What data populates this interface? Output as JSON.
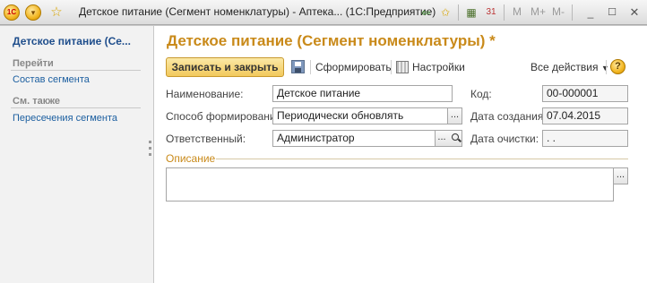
{
  "titlebar": {
    "logo": "1С",
    "title": "Детское питание (Сегмент номенклатуры) - Аптека... (1С:Предприятие)",
    "m_labels": [
      "M",
      "M+",
      "M-"
    ],
    "icons": [
      "app-logo-icon",
      "menu-dropdown-icon",
      "favorite-star-icon",
      "back-icon",
      "bookmark-icon",
      "calculator-icon",
      "calendar-icon",
      "minimize-icon",
      "maximize-icon",
      "close-icon"
    ]
  },
  "leftpanel": {
    "title": "Детское питание (Се...",
    "goto_section": "Перейти",
    "goto_items": [
      "Состав сегмента"
    ],
    "see_also_section": "См. также",
    "see_also_items": [
      "Пересечения сегмента"
    ]
  },
  "form": {
    "title": "Детское питание (Сегмент номенклатуры) *",
    "toolbar": {
      "save_close": "Записать и закрыть",
      "generate": "Сформировать",
      "settings": "Настройки",
      "all_actions": "Все действия",
      "help": "?"
    },
    "fields": {
      "name_label": "Наименование:",
      "name_value": "Детское питание",
      "method_label": "Способ формирования:",
      "method_value": "Периодически обновлять",
      "responsible_label": "Ответственный:",
      "responsible_value": "Администратор",
      "code_label": "Код:",
      "code_value": "00-000001",
      "created_label": "Дата создания:",
      "created_value": "07.04.2015",
      "cleared_label": "Дата очистки:",
      "cleared_value": " .  ."
    },
    "description_label": "Описание"
  },
  "colors": {
    "title_accent": "#c98a1a",
    "link": "#1c5fa0",
    "primary_button": "#f2c95c"
  }
}
